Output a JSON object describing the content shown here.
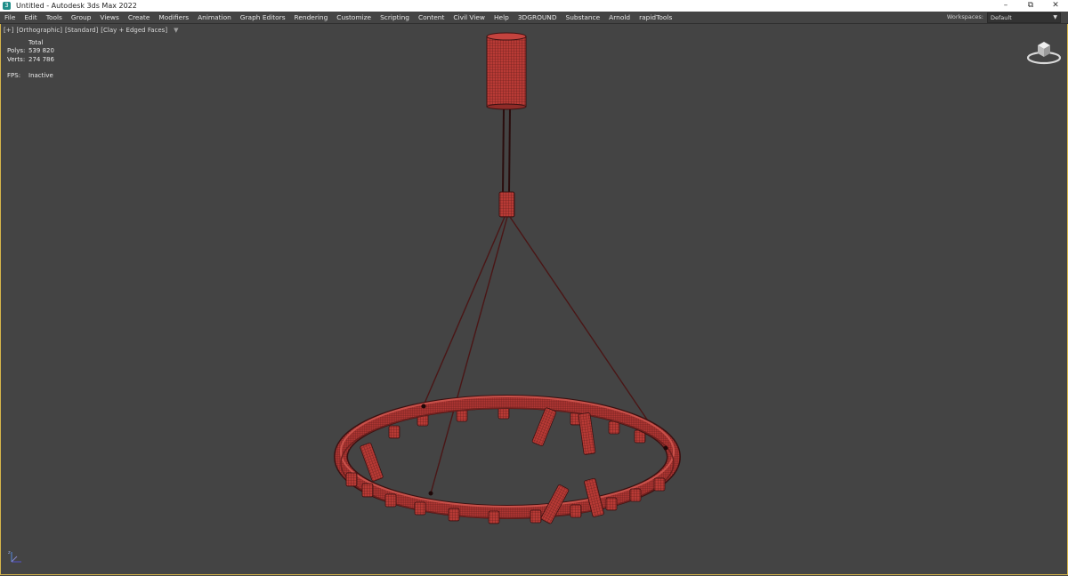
{
  "window": {
    "title": "Untitled - Autodesk 3ds Max 2022",
    "app_icon": "3ds-max-app-icon",
    "controls": {
      "minimize": "–",
      "restore": "⧉",
      "close": "✕"
    }
  },
  "menubar": {
    "items": [
      "File",
      "Edit",
      "Tools",
      "Group",
      "Views",
      "Create",
      "Modifiers",
      "Animation",
      "Graph Editors",
      "Rendering",
      "Customize",
      "Scripting",
      "Content",
      "Civil View",
      "Help",
      "3DGROUND",
      "Substance",
      "Arnold",
      "rapidTools"
    ],
    "workspaces_label": "Workspaces:",
    "workspaces_value": "Default"
  },
  "viewport": {
    "labels": [
      "[+]",
      "[Orthographic]",
      "[Standard]",
      "[Clay + Edged Faces]"
    ],
    "filter_icon": "filter-icon",
    "stats": {
      "header": "Total",
      "polys_label": "Polys:",
      "polys_value": "539 820",
      "verts_label": "Verts:",
      "verts_value": "274 786",
      "fps_label": "FPS:",
      "fps_value": "Inactive"
    },
    "model_color": "#b83a35",
    "wire_color": "#3a1212",
    "border_color": "#d6b54a"
  }
}
